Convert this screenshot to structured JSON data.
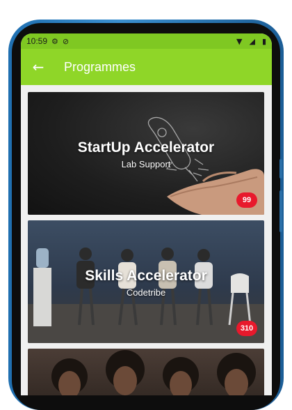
{
  "status": {
    "time": "10:59",
    "icons": [
      "gear-icon",
      "sync-icon",
      "wifi-icon",
      "signal-icon",
      "battery-icon"
    ]
  },
  "appbar": {
    "back_icon": "arrow-left-icon",
    "title": "Programmes",
    "color": "#8fd628"
  },
  "programmes": [
    {
      "title": "StartUp Accelerator",
      "subtitle": "Lab Support",
      "count": "99",
      "image": "rocket-hand-chalk"
    },
    {
      "title": "Skills Accelerator",
      "subtitle": "Codetribe",
      "count": "310",
      "image": "people-waiting-office"
    },
    {
      "title": "",
      "subtitle": "",
      "count": "",
      "image": "group-of-women"
    }
  ],
  "badge_color": "#e8192c"
}
